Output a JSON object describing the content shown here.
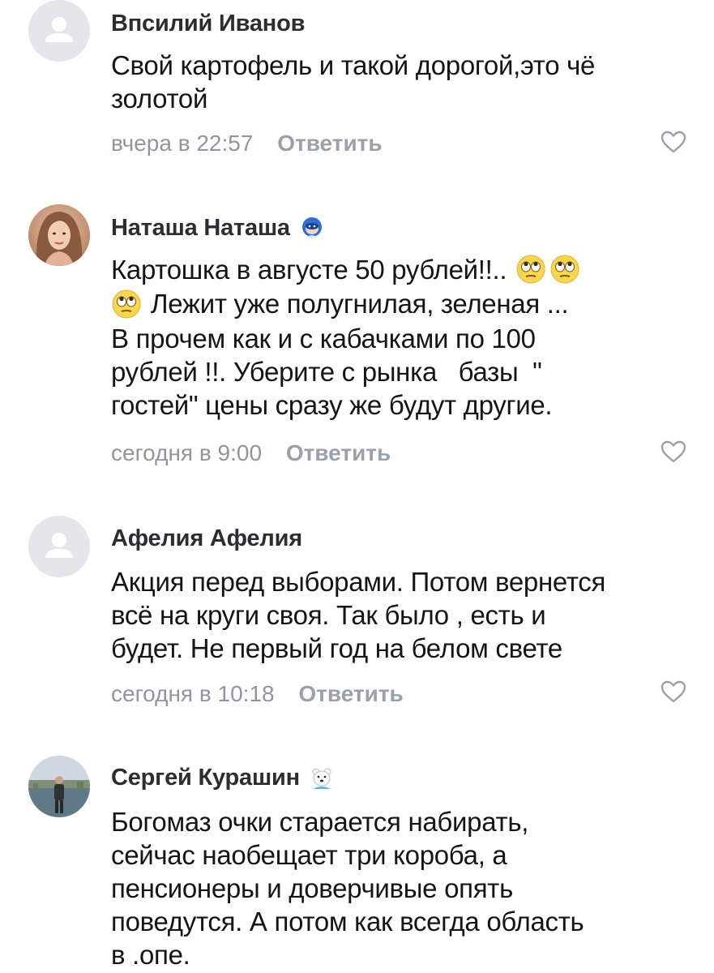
{
  "comments": [
    {
      "author": "Впсилий Иванов",
      "text_lines": [
        "Свой картофель и такой дорогой,это чё",
        "золотой"
      ],
      "time": "вчера в 22:57",
      "reply": "Ответить",
      "avatar_icon": "default-user-icon",
      "badge_icon": null
    },
    {
      "author": "Наташа Наташа",
      "text_lines": [
        "Картошка в августе 50 рублей!!..",
        "Лежит уже полугнилая, зеленая ...",
        "В прочем как и с кабачками по 100",
        "рублей !!. Уберите с рынка   базы  \"",
        "гостей\" цены сразу же будут другие."
      ],
      "time": "сегодня в 9:00",
      "reply": "Ответить",
      "avatar_icon": "user-photo-woman",
      "badge_icon": "astronaut-emoji-icon",
      "inline_emoji": "eye-roll-emoji-icon"
    },
    {
      "author": "Афелия Афелия",
      "text_lines": [
        "Акция перед выборами. Потом вернется",
        "всё на круги своя. Так было , есть и",
        "будет. Не первый год на белом свете"
      ],
      "time": "сегодня в 10:18",
      "reply": "Ответить",
      "avatar_icon": "default-user-icon",
      "badge_icon": null
    },
    {
      "author": "Сергей Курашин",
      "text_lines": [
        "Богомаз очки старается набирать,",
        "сейчас наобещает три короба, а",
        "пенсионеры и доверчивые опять",
        "поведутся. А потом как всегда область",
        "в .опе."
      ],
      "time": null,
      "reply": null,
      "avatar_icon": "user-photo-man-outdoors",
      "badge_icon": "polar-bear-emoji-icon"
    }
  ],
  "icons": {
    "like": "heart-outline-icon"
  },
  "colors": {
    "author": "#2c2d2e",
    "text": "#151515",
    "meta": "#8f96a0",
    "reply": "#9aa1ab",
    "avatar_placeholder_bg": "#e3e7ec",
    "avatar_placeholder_fg": "#ffffff"
  }
}
